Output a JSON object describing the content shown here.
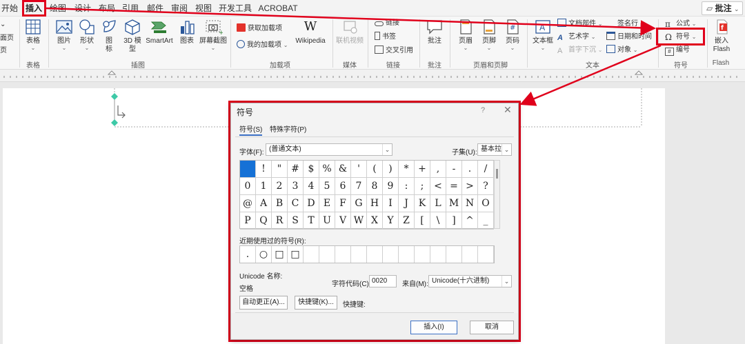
{
  "menu": {
    "tabs": [
      "开始",
      "插入",
      "绘图",
      "设计",
      "布局",
      "引用",
      "邮件",
      "审阅",
      "视图",
      "开发工具",
      "ACROBAT"
    ],
    "comments_button": "批注"
  },
  "ribbon": {
    "edge": {
      "e1": "⌄",
      "e2": "面页",
      "e3": "页"
    },
    "tables": {
      "table_label": "表格",
      "group": "表格"
    },
    "illustrations": {
      "picture": "图片",
      "shapes": "形状",
      "icons_line1": "图",
      "icons_line2": "标",
      "model3d_line1": "3D 模",
      "model3d_line2": "型",
      "smartart": "SmartArt",
      "chart": "图表",
      "screenshot": "屏幕截图",
      "group": "插图"
    },
    "addins": {
      "get_addins": "获取加载项",
      "my_addins": "我的加载项",
      "wikipedia": "Wikipedia",
      "group": "加载项"
    },
    "media": {
      "online_video": "联机视频",
      "group": "媒体"
    },
    "links": {
      "link": "链接",
      "bookmark": "书签",
      "cross_ref": "交叉引用",
      "group": "链接"
    },
    "comments": {
      "comment": "批注",
      "group": "批注"
    },
    "header_footer": {
      "header": "页眉",
      "footer": "页脚",
      "page_number": "页码",
      "group": "页眉和页脚"
    },
    "text": {
      "textbox": "文本框",
      "quick_parts": "文档部件",
      "wordart": "艺术字",
      "dropcap": "首字下沉",
      "signature": "签名行",
      "datetime": "日期和时间",
      "object": "对象",
      "group": "文本"
    },
    "symbols": {
      "equation": "公式",
      "symbol": "符号",
      "numbering": "编号",
      "group": "符号"
    },
    "flash": {
      "embed_line1": "嵌入",
      "embed_line2": "Flash",
      "group": "Flash"
    }
  },
  "dialog": {
    "title": "符号",
    "help": "?",
    "close": "✕",
    "tabs": [
      "符号(S)",
      "特殊字符(P)"
    ],
    "font_label": "字体(F):",
    "font_value": "(普通文本)",
    "subset_label": "子集(U):",
    "subset_value": "基本拉丁",
    "symbols": [
      [
        "",
        "!",
        "\"",
        "#",
        "$",
        "%",
        "&",
        "'",
        "(",
        ")",
        "*",
        "+",
        ",",
        "-",
        ".",
        "/"
      ],
      [
        "0",
        "1",
        "2",
        "3",
        "4",
        "5",
        "6",
        "7",
        "8",
        "9",
        ":",
        ";",
        "<",
        "=",
        ">",
        "?"
      ],
      [
        "@",
        "A",
        "B",
        "C",
        "D",
        "E",
        "F",
        "G",
        "H",
        "I",
        "J",
        "K",
        "L",
        "M",
        "N",
        "O"
      ],
      [
        "P",
        "Q",
        "R",
        "S",
        "T",
        "U",
        "V",
        "W",
        "X",
        "Y",
        "Z",
        "[",
        "\\",
        "]",
        "^",
        "_"
      ]
    ],
    "recent_label": "近期使用过的符号(R):",
    "recent_symbols": [
      ".",
      "○",
      "□",
      "□",
      "",
      "",
      "",
      "",
      "",
      "",
      "",
      "",
      "",
      "",
      "",
      ""
    ],
    "unicode_name_label": "Unicode 名称:",
    "unicode_name_value": "空格",
    "char_code_label": "字符代码(C):",
    "char_code_value": "0020",
    "from_label": "来自(M):",
    "from_value": "Unicode(十六进制)",
    "autocorrect_button": "自动更正(A)...",
    "shortcut_key_button": "快捷键(K)...",
    "shortcut_label": "快捷键:",
    "insert_button": "插入(I)",
    "cancel_button": "取消"
  },
  "annotation_color": "#e0001b"
}
